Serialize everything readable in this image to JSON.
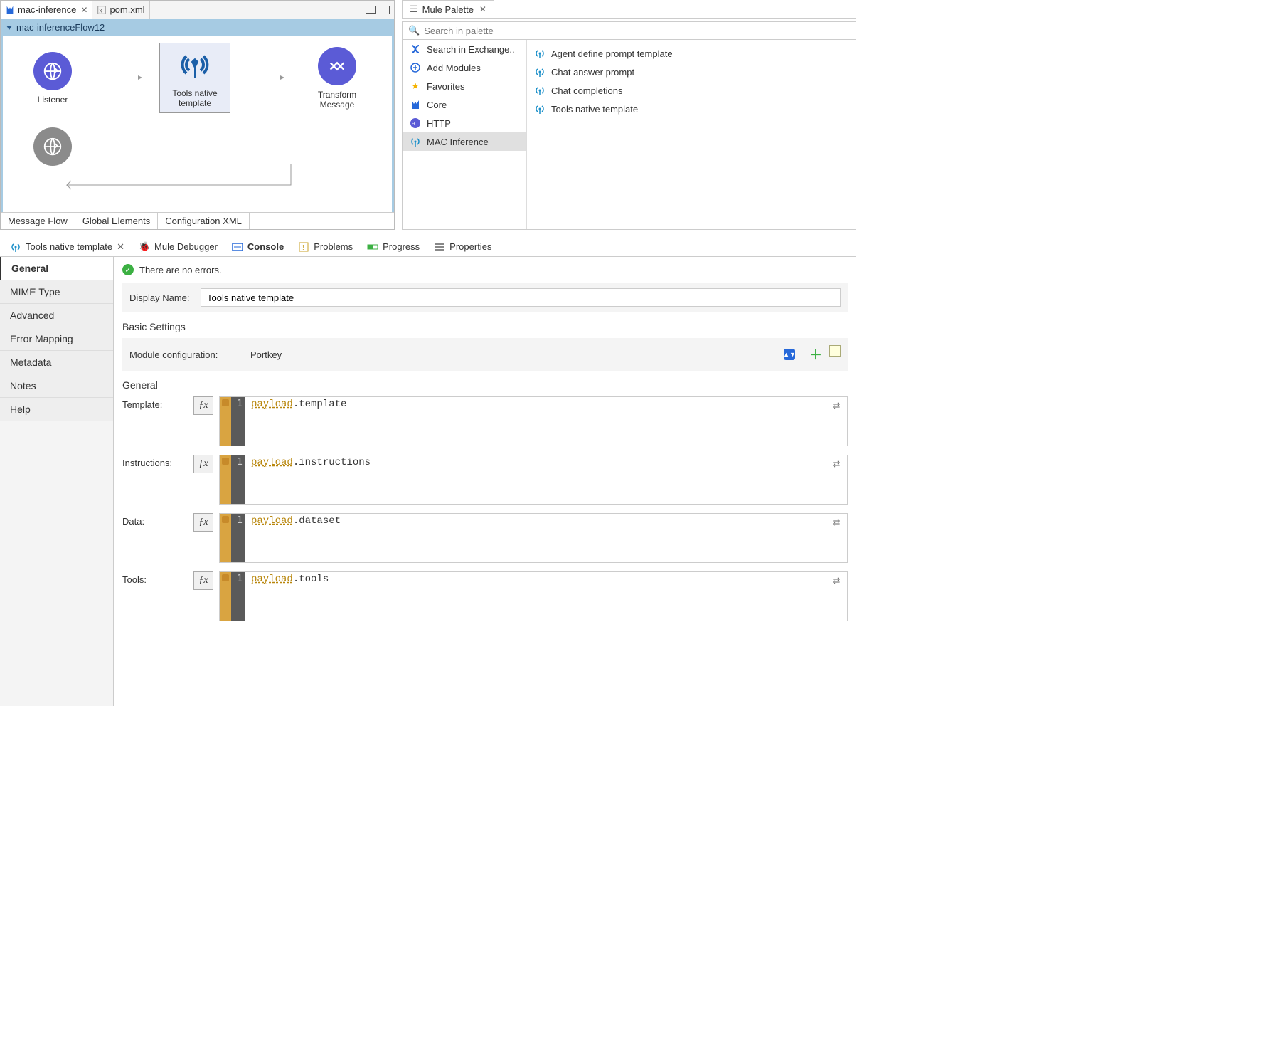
{
  "editor": {
    "tabs": [
      {
        "label": "mac-inference",
        "active": true,
        "closable": true
      },
      {
        "label": "pom.xml",
        "active": false,
        "closable": false
      }
    ],
    "flow_name": "mac-inferenceFlow12",
    "nodes": {
      "listener": "Listener",
      "tools": "Tools native\ntemplate",
      "transform": "Transform\nMessage"
    },
    "bottom_tabs": [
      "Message Flow",
      "Global Elements",
      "Configuration XML"
    ]
  },
  "palette": {
    "title": "Mule Palette",
    "search_placeholder": "Search in palette",
    "left": [
      {
        "label": "Search in Exchange..",
        "icon": "exchange"
      },
      {
        "label": "Add Modules",
        "icon": "plus"
      },
      {
        "label": "Favorites",
        "icon": "star"
      },
      {
        "label": "Core",
        "icon": "core"
      },
      {
        "label": "HTTP",
        "icon": "http"
      },
      {
        "label": "MAC Inference",
        "icon": "antenna",
        "selected": true
      }
    ],
    "right": [
      "Agent define prompt template",
      "Chat answer prompt",
      "Chat completions",
      "Tools native template"
    ]
  },
  "views": [
    {
      "label": "Tools native template",
      "icon": "antenna",
      "closable": true
    },
    {
      "label": "Mule Debugger",
      "icon": "bug"
    },
    {
      "label": "Console",
      "icon": "console",
      "active": true
    },
    {
      "label": "Problems",
      "icon": "problems"
    },
    {
      "label": "Progress",
      "icon": "progress"
    },
    {
      "label": "Properties",
      "icon": "properties"
    }
  ],
  "props": {
    "status": "There are no errors.",
    "sidebar": [
      "General",
      "MIME Type",
      "Advanced",
      "Error Mapping",
      "Metadata",
      "Notes",
      "Help"
    ],
    "display_name_label": "Display Name:",
    "display_name_value": "Tools native template",
    "basic_settings": "Basic Settings",
    "module_conf_label": "Module configuration:",
    "module_conf_value": "Portkey",
    "general_title": "General",
    "rows": [
      {
        "label": "Template:",
        "line": "1",
        "pre": "payload",
        "post": ".template"
      },
      {
        "label": "Instructions:",
        "line": "1",
        "pre": "payload",
        "post": ".instructions"
      },
      {
        "label": "Data:",
        "line": "1",
        "pre": "payload",
        "post": ".dataset"
      },
      {
        "label": "Tools:",
        "line": "1",
        "pre": "payload",
        "post": ".tools"
      }
    ]
  }
}
